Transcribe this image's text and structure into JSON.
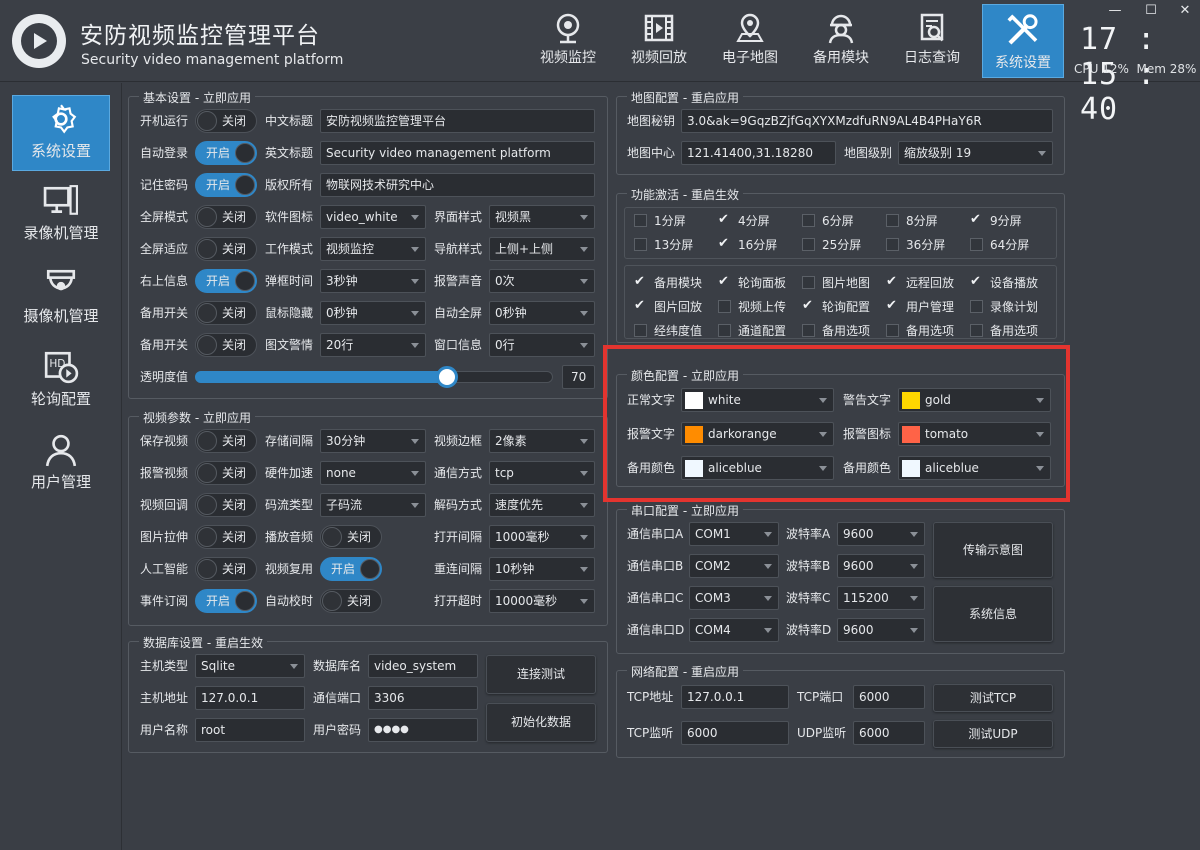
{
  "header": {
    "title": "安防视频监控管理平台",
    "subtitle": "Security video management platform",
    "nav": [
      {
        "label": "视频监控",
        "icon": "webcam-icon"
      },
      {
        "label": "视频回放",
        "icon": "film-icon"
      },
      {
        "label": "电子地图",
        "icon": "map-pin-icon"
      },
      {
        "label": "备用模块",
        "icon": "worker-icon"
      },
      {
        "label": "日志查询",
        "icon": "log-search-icon"
      },
      {
        "label": "系统设置",
        "icon": "tools-icon"
      }
    ],
    "clock": "17:15:40",
    "cpu": "CPU 12%",
    "mem": "Mem 28%"
  },
  "sidebar": [
    {
      "label": "系统设置",
      "icon": "gear-icon"
    },
    {
      "label": "录像机管理",
      "icon": "nvr-icon"
    },
    {
      "label": "摄像机管理",
      "icon": "dome-camera-icon"
    },
    {
      "label": "轮询配置",
      "icon": "poll-icon"
    },
    {
      "label": "用户管理",
      "icon": "user-icon"
    }
  ],
  "basic": {
    "title": "基本设置 - 立即应用",
    "rows": [
      {
        "l1": "开机运行",
        "t1": "关闭",
        "l2": "中文标题",
        "v2": "安防视频监控管理平台"
      },
      {
        "l1": "自动登录",
        "t1": "开启",
        "l2": "英文标题",
        "v2": "Security video management platform"
      },
      {
        "l1": "记住密码",
        "t1": "开启",
        "l2": "版权所有",
        "v2": "物联网技术研究中心"
      },
      {
        "l1": "全屏模式",
        "t1": "关闭",
        "l2": "软件图标",
        "v2": "video_white",
        "l3": "界面样式",
        "v3": "视频黑"
      },
      {
        "l1": "全屏适应",
        "t1": "关闭",
        "l2": "工作模式",
        "v2": "视频监控",
        "l3": "导航样式",
        "v3": "上侧+上侧"
      },
      {
        "l1": "右上信息",
        "t1": "开启",
        "l2": "弹框时间",
        "v2": "3秒钟",
        "l3": "报警声音",
        "v3": "0次"
      },
      {
        "l1": "备用开关",
        "t1": "关闭",
        "l2": "鼠标隐藏",
        "v2": "0秒钟",
        "l3": "自动全屏",
        "v3": "0秒钟"
      },
      {
        "l1": "备用开关",
        "t1": "关闭",
        "l2": "图文警情",
        "v2": "20行",
        "l3": "窗口信息",
        "v3": "0行"
      }
    ],
    "opacity_label": "透明度值",
    "opacity_value": "70",
    "opacity_fraction": 0.7
  },
  "video": {
    "title": "视频参数 - 立即应用",
    "rows": [
      {
        "l1": "保存视频",
        "t1": "关闭",
        "l2": "存储间隔",
        "v2": "30分钟",
        "l3": "视频边框",
        "v3": "2像素"
      },
      {
        "l1": "报警视频",
        "t1": "关闭",
        "l2": "硬件加速",
        "v2": "none",
        "l3": "通信方式",
        "v3": "tcp"
      },
      {
        "l1": "视频回调",
        "t1": "关闭",
        "l2": "码流类型",
        "v2": "子码流",
        "l3": "解码方式",
        "v3": "速度优先"
      },
      {
        "l1": "图片拉伸",
        "t1": "关闭",
        "l2": "播放音频",
        "t2": "关闭",
        "l3": "打开间隔",
        "v3": "1000毫秒"
      },
      {
        "l1": "人工智能",
        "t1": "关闭",
        "l2": "视频复用",
        "t2": "开启",
        "l3": "重连间隔",
        "v3": "10秒钟"
      },
      {
        "l1": "事件订阅",
        "t1": "开启",
        "l2": "自动校时",
        "t2": "关闭",
        "l3": "打开超时",
        "v3": "10000毫秒"
      }
    ]
  },
  "db": {
    "title": "数据库设置 - 重启生效",
    "type_label": "主机类型",
    "type": "Sqlite",
    "name_label": "数据库名",
    "name": "video_system",
    "host_label": "主机地址",
    "host": "127.0.0.1",
    "port_label": "通信端口",
    "port": "3306",
    "user_label": "用户名称",
    "user": "root",
    "pwd_label": "用户密码",
    "pwd": "●●●●",
    "btn_test": "连接测试",
    "btn_init": "初始化数据"
  },
  "map": {
    "title": "地图配置 - 重启应用",
    "key_label": "地图秘钥",
    "key": "3.0&ak=9GqzBZjfGqXYXMzdfuRN9AL4B4PHaY6R",
    "center_label": "地图中心",
    "center": "121.41400,31.18280",
    "level_label": "地图级别",
    "level": "缩放级别 19"
  },
  "func": {
    "title": "功能激活 - 重启生效",
    "screens": [
      {
        "t": "1分屏",
        "c": false
      },
      {
        "t": "4分屏",
        "c": true
      },
      {
        "t": "6分屏",
        "c": false
      },
      {
        "t": "8分屏",
        "c": false
      },
      {
        "t": "9分屏",
        "c": true
      },
      {
        "t": "13分屏",
        "c": false
      },
      {
        "t": "16分屏",
        "c": true
      },
      {
        "t": "25分屏",
        "c": false
      },
      {
        "t": "36分屏",
        "c": false
      },
      {
        "t": "64分屏",
        "c": false
      }
    ],
    "modules": [
      {
        "t": "备用模块",
        "c": true
      },
      {
        "t": "轮询面板",
        "c": true
      },
      {
        "t": "图片地图",
        "c": false
      },
      {
        "t": "远程回放",
        "c": true
      },
      {
        "t": "设备播放",
        "c": true
      },
      {
        "t": "图片回放",
        "c": true
      },
      {
        "t": "视频上传",
        "c": false
      },
      {
        "t": "轮询配置",
        "c": true
      },
      {
        "t": "用户管理",
        "c": true
      },
      {
        "t": "录像计划",
        "c": false
      },
      {
        "t": "经纬度值",
        "c": false
      },
      {
        "t": "通道配置",
        "c": false
      },
      {
        "t": "备用选项",
        "c": false
      },
      {
        "t": "备用选项",
        "c": false
      },
      {
        "t": "备用选项",
        "c": false
      }
    ]
  },
  "color": {
    "title": "颜色配置 - 立即应用",
    "items": [
      {
        "l": "正常文字",
        "v": "white",
        "c": "#ffffff"
      },
      {
        "l": "警告文字",
        "v": "gold",
        "c": "#ffd700"
      },
      {
        "l": "报警文字",
        "v": "darkorange",
        "c": "#ff8c00"
      },
      {
        "l": "报警图标",
        "v": "tomato",
        "c": "#ff6347"
      },
      {
        "l": "备用颜色",
        "v": "aliceblue",
        "c": "#f0f8ff"
      },
      {
        "l": "备用颜色",
        "v": "aliceblue",
        "c": "#f0f8ff"
      }
    ]
  },
  "serial": {
    "title": "串口配置 - 立即应用",
    "rows": [
      {
        "l1": "通信串口A",
        "v1": "COM1",
        "l2": "波特率A",
        "v2": "9600"
      },
      {
        "l1": "通信串口B",
        "v1": "COM2",
        "l2": "波特率B",
        "v2": "9600"
      },
      {
        "l1": "通信串口C",
        "v1": "COM3",
        "l2": "波特率C",
        "v2": "115200"
      },
      {
        "l1": "通信串口D",
        "v1": "COM4",
        "l2": "波特率D",
        "v2": "9600"
      }
    ],
    "btn1": "传输示意图",
    "btn2": "系统信息"
  },
  "net": {
    "title": "网络配置 - 重启应用",
    "tcp_addr_label": "TCP地址",
    "tcp_addr": "127.0.0.1",
    "tcp_port_label": "TCP端口",
    "tcp_port": "6000",
    "tcp_listen_label": "TCP监听",
    "tcp_listen": "6000",
    "udp_listen_label": "UDP监听",
    "udp_listen": "6000",
    "btn_tcp": "测试TCP",
    "btn_udp": "测试UDP"
  },
  "colors": {
    "accent": "#2f87c7",
    "highlight": "#e3342f"
  }
}
